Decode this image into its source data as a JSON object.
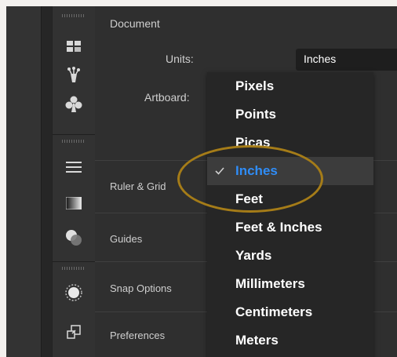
{
  "document": {
    "title": "Document",
    "units_label": "Units:",
    "units_value": "Inches",
    "artboard_label": "Artboard:"
  },
  "sections": {
    "ruler_grid": "Ruler & Grid",
    "guides": "Guides",
    "snap_options": "Snap Options",
    "preferences": "Preferences"
  },
  "units_options": [
    {
      "label": "Pixels"
    },
    {
      "label": "Points"
    },
    {
      "label": "Picas"
    },
    {
      "label": "Inches",
      "selected": true
    },
    {
      "label": "Feet"
    },
    {
      "label": "Feet & Inches"
    },
    {
      "label": "Yards"
    },
    {
      "label": "Millimeters"
    },
    {
      "label": "Centimeters"
    },
    {
      "label": "Meters"
    }
  ],
  "toolbar_icons": [
    "artboards-icon",
    "puppet-warp-icon",
    "club-symbol-icon",
    "align-icon",
    "gradient-icon",
    "transparency-icon",
    "appearance-icon",
    "export-icon"
  ],
  "colors": {
    "accent_blue": "#2f8df8",
    "highlight_ring": "#a57c18",
    "panel_bg": "#2f2f2f",
    "dropdown_bg": "#262626"
  }
}
